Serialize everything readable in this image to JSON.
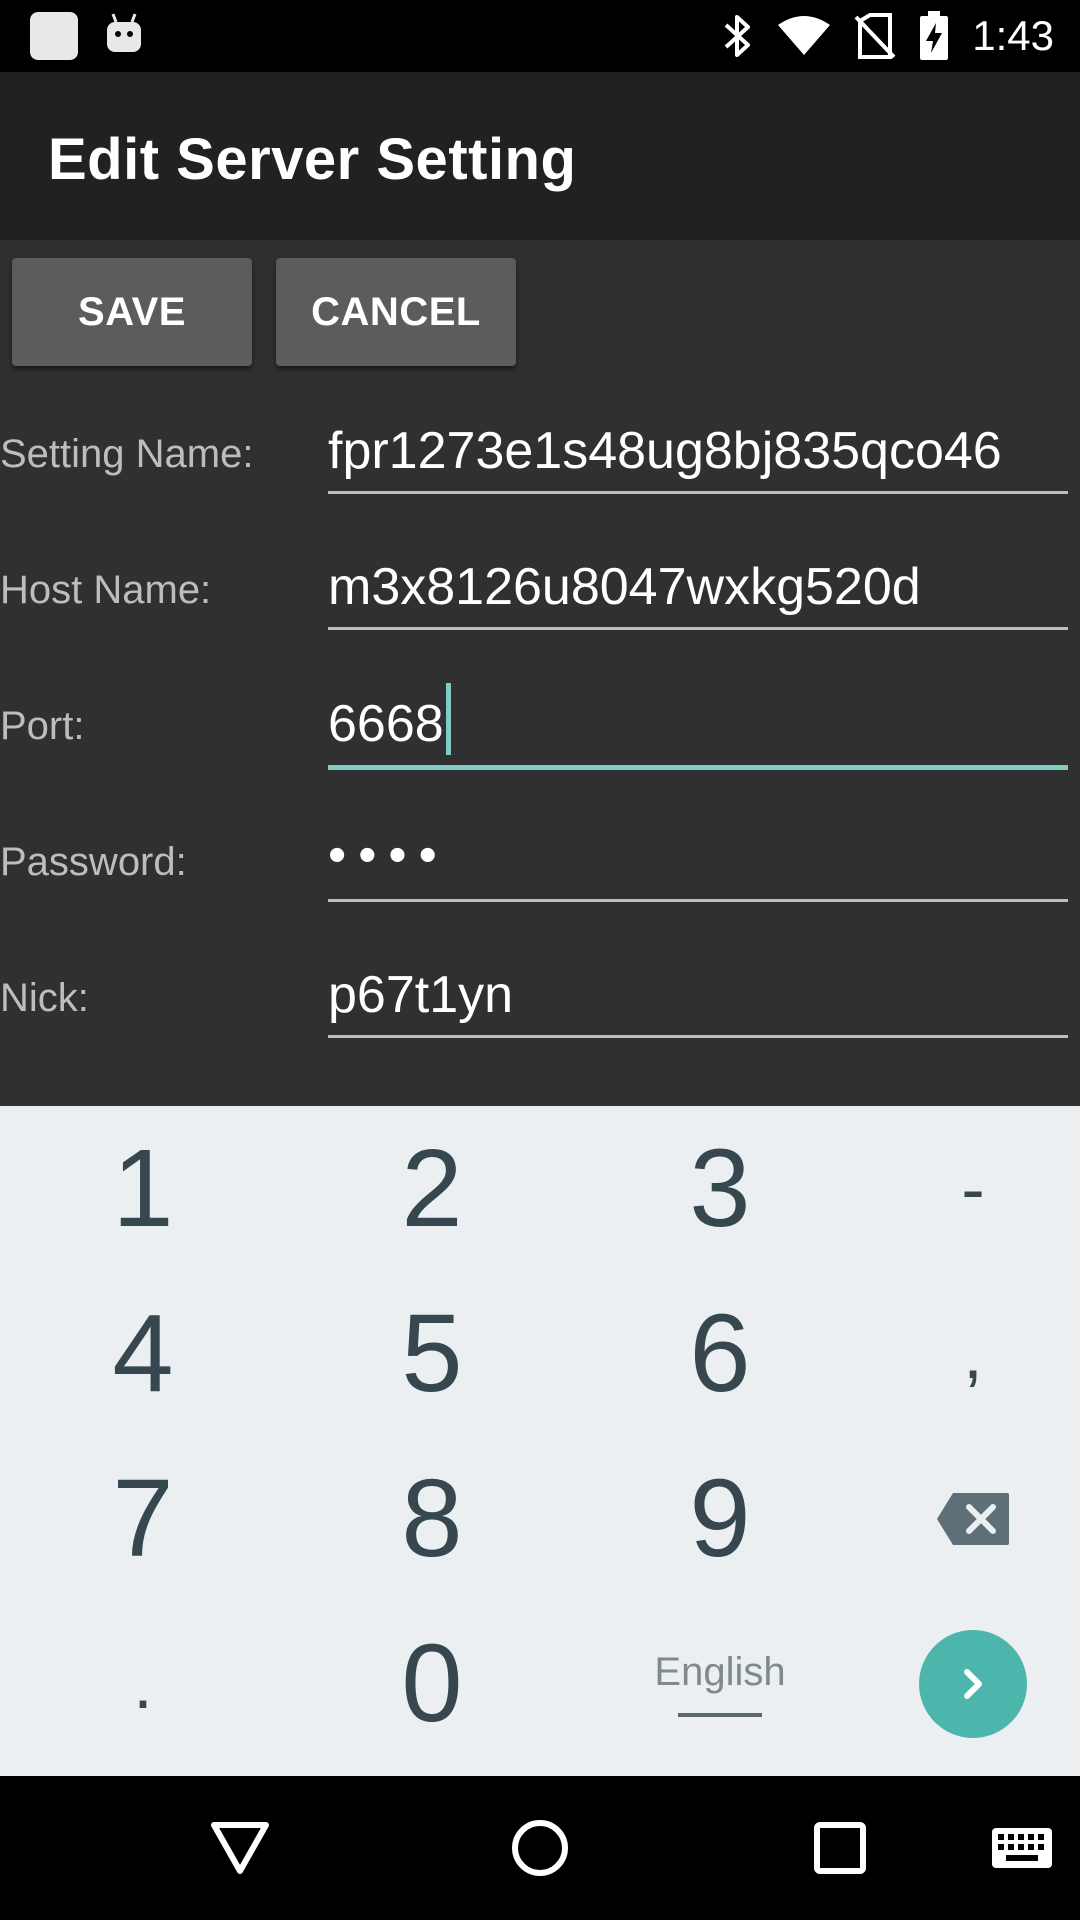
{
  "status_bar": {
    "time": "1:43",
    "icons": [
      "notification-app-icon",
      "android-debug-icon",
      "bluetooth-icon",
      "wifi-icon",
      "no-sim-icon",
      "battery-charging-icon"
    ]
  },
  "app_bar": {
    "title": "Edit Server Setting"
  },
  "toolbar": {
    "save_label": "SAVE",
    "cancel_label": "CANCEL"
  },
  "form": {
    "setting_name": {
      "label": "Setting Name:",
      "value": "fpr1273e1s48ug8bj835qco46"
    },
    "host_name": {
      "label": "Host Name:",
      "value": "m3x8126u8047wxkg520d"
    },
    "port": {
      "label": "Port:",
      "value": "6668"
    },
    "password": {
      "label": "Password:",
      "value": "••••"
    },
    "nick": {
      "label": "Nick:",
      "value": "p67t1yn"
    }
  },
  "keyboard": {
    "keys": [
      "1",
      "2",
      "3",
      "-",
      "4",
      "5",
      "6",
      ",",
      "7",
      "8",
      "9",
      ".",
      "0"
    ],
    "language": "English",
    "icons": [
      "backspace-icon",
      "enter-arrow-icon"
    ]
  },
  "nav_bar": {
    "icons": [
      "back-icon",
      "home-icon",
      "recents-icon",
      "keyboard-switch-icon"
    ]
  },
  "colors": {
    "accent": "#80cbc4",
    "enter_button": "#4db6ac",
    "app_bar": "#212121",
    "background": "#303030"
  }
}
